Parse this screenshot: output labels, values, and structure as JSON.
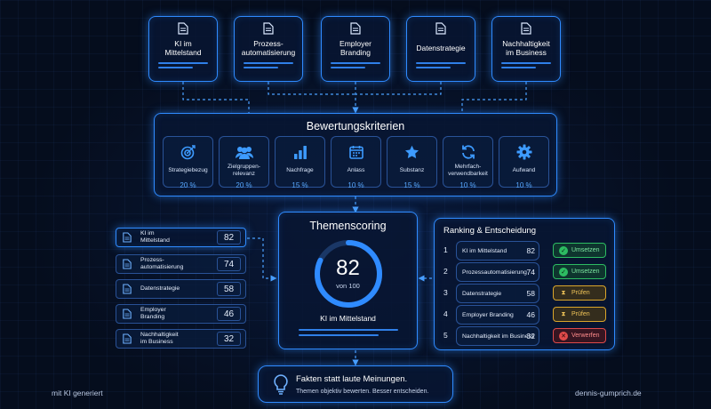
{
  "topics": [
    {
      "label": "KI im\nMittelstand"
    },
    {
      "label": "Prozess-\nautomatisierung"
    },
    {
      "label": "Employer\nBranding"
    },
    {
      "label": "Datenstrategie"
    },
    {
      "label": "Nachhaltigkeit\nim Business"
    }
  ],
  "criteria": {
    "title": "Bewertungskriterien",
    "items": [
      {
        "icon": "target-icon",
        "label": "Strategiebezug",
        "weight": "20 %"
      },
      {
        "icon": "users-icon",
        "label": "Zielgruppen-\nrelevanz",
        "weight": "20 %"
      },
      {
        "icon": "bar-chart-icon",
        "label": "Nachfrage",
        "weight": "15 %"
      },
      {
        "icon": "calendar-icon",
        "label": "Anlass",
        "weight": "10 %"
      },
      {
        "icon": "star-icon",
        "label": "Substanz",
        "weight": "15 %"
      },
      {
        "icon": "refresh-icon",
        "label": "Mehrfach-\nverwendbarkeit",
        "weight": "10 %"
      },
      {
        "icon": "gear-icon",
        "label": "Aufwand",
        "weight": "10 %"
      }
    ]
  },
  "scores": [
    {
      "label": "KI im\nMittelstand",
      "score": "82"
    },
    {
      "label": "Prozess-\nautomatisierung",
      "score": "74"
    },
    {
      "label": "Datenstrategie",
      "score": "58"
    },
    {
      "label": "Employer\nBranding",
      "score": "46"
    },
    {
      "label": "Nachhaltigkeit\nim Business",
      "score": "32"
    }
  ],
  "scoring": {
    "title": "Themenscoring",
    "value": "82",
    "value_fraction": 0.82,
    "subtitle": "von 100",
    "topic": "KI im Mittelstand"
  },
  "ranking": {
    "title": "Ranking & Entscheidung",
    "rows": [
      {
        "rank": "1",
        "label": "KI im Mittelstand",
        "score": "82",
        "decision": "Umsetzen",
        "status": "ok"
      },
      {
        "rank": "2",
        "label": "Prozessautomatisierung",
        "score": "74",
        "decision": "Umsetzen",
        "status": "ok"
      },
      {
        "rank": "3",
        "label": "Datenstrategie",
        "score": "58",
        "decision": "Prüfen",
        "status": "warn"
      },
      {
        "rank": "4",
        "label": "Employer Branding",
        "score": "46",
        "decision": "Prüfen",
        "status": "warn"
      },
      {
        "rank": "5",
        "label": "Nachhaltigkeit im Business",
        "score": "32",
        "decision": "Verwerfen",
        "status": "bad"
      }
    ]
  },
  "tagline": {
    "headline": "Fakten statt laute Meinungen.",
    "sub": "Themen objektiv bewerten. Besser entscheiden."
  },
  "footer": {
    "left": "mit KI generiert",
    "right": "dennis-gumprich.de"
  },
  "colors": {
    "accent": "#2f8bff",
    "ok": "#2dbb62",
    "warn": "#d9a52b",
    "bad": "#e04a4a"
  }
}
